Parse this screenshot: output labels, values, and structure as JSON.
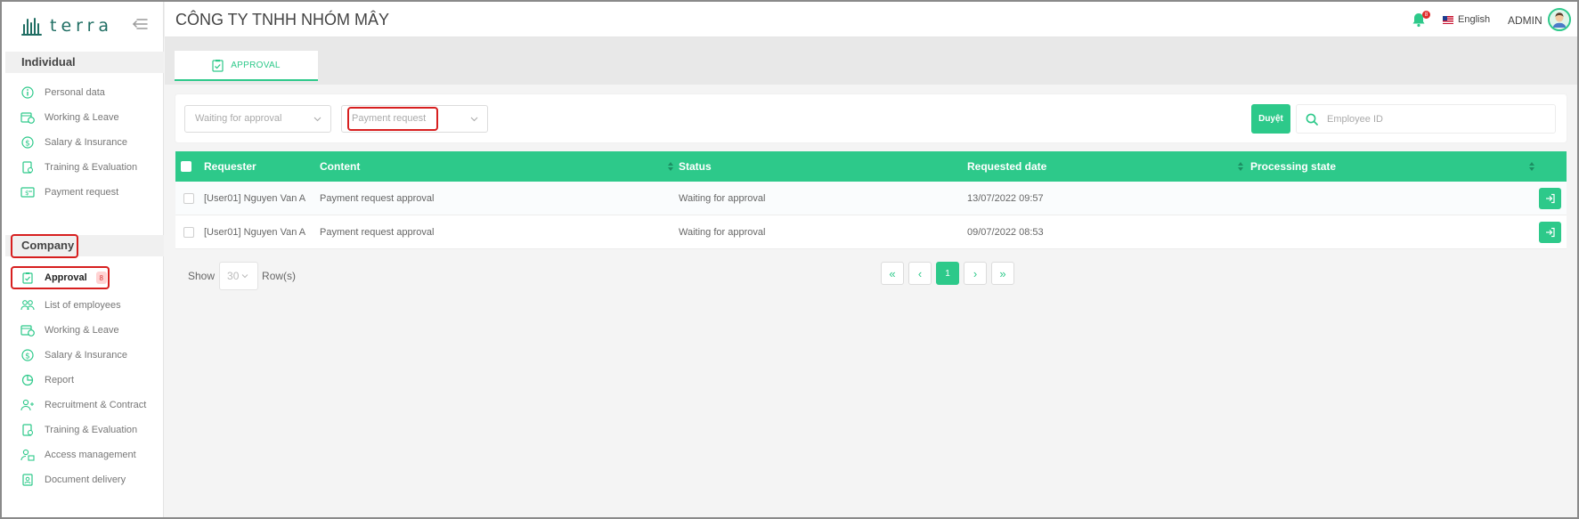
{
  "app": {
    "logo_text": "terra"
  },
  "header": {
    "company_name": "CÔNG TY TNHH NHÓM MÂY",
    "notification_count": "8",
    "language": "English",
    "user": "ADMIN"
  },
  "sidebar": {
    "individual_label": "Individual",
    "individual_items": [
      {
        "label": "Personal data",
        "icon": "info-icon"
      },
      {
        "label": "Working & Leave",
        "icon": "clock-calendar-icon"
      },
      {
        "label": "Salary & Insurance",
        "icon": "dollar-icon"
      },
      {
        "label": "Training & Evaluation",
        "icon": "training-icon"
      },
      {
        "label": "Payment request",
        "icon": "payment-icon"
      }
    ],
    "company_label": "Company",
    "company_items": [
      {
        "label": "Approval",
        "icon": "clipboard-check-icon",
        "badge": "8"
      },
      {
        "label": "List of employees",
        "icon": "users-icon"
      },
      {
        "label": "Working & Leave",
        "icon": "clock-calendar-icon"
      },
      {
        "label": "Salary & Insurance",
        "icon": "dollar-icon"
      },
      {
        "label": "Report",
        "icon": "pie-chart-icon"
      },
      {
        "label": "Recruitment & Contract",
        "icon": "user-plus-icon"
      },
      {
        "label": "Training & Evaluation",
        "icon": "training-icon"
      },
      {
        "label": "Access management",
        "icon": "user-lock-icon"
      },
      {
        "label": "Document delivery",
        "icon": "document-icon"
      }
    ]
  },
  "tabs": [
    {
      "label": "APPROVAL",
      "active": true
    }
  ],
  "filters": {
    "status_select": "Waiting for approval",
    "type_select": "Payment request",
    "approve_button": "Duyệt",
    "search_placeholder": "Employee ID"
  },
  "table": {
    "columns": [
      "Requester",
      "Content",
      "Status",
      "Requested date",
      "Processing state"
    ],
    "rows": [
      {
        "requester": "[User01] Nguyen Van A",
        "content": "Payment request approval",
        "status": "Waiting for approval",
        "date": "13/07/2022 09:57",
        "state": ""
      },
      {
        "requester": "[User01] Nguyen Van A",
        "content": "Payment request approval",
        "status": "Waiting for approval",
        "date": "09/07/2022 08:53",
        "state": ""
      }
    ]
  },
  "pagination": {
    "show_label": "Show",
    "page_size": "30",
    "rows_label": "Row(s)",
    "first": "«",
    "prev": "‹",
    "current": "1",
    "next": "›",
    "last": "»"
  },
  "colors": {
    "accent": "#2dc98a",
    "highlight": "#d71f1f",
    "brand": "#1f6e63"
  }
}
